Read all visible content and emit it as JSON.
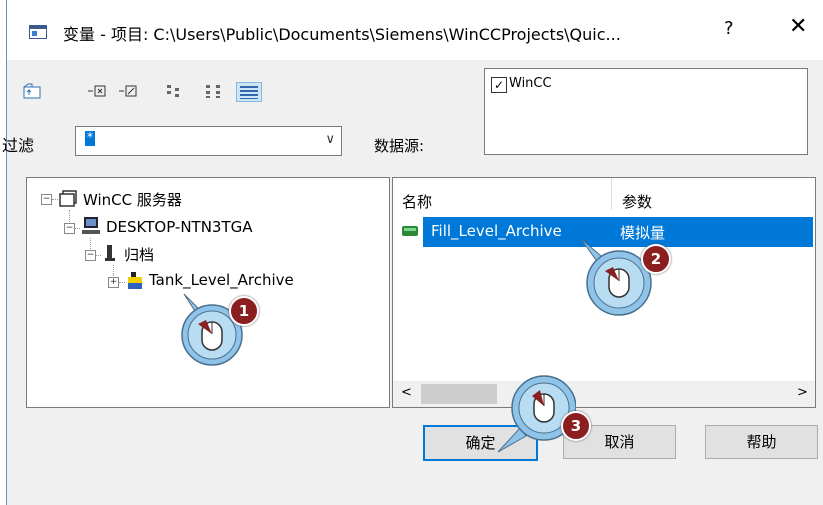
{
  "window": {
    "title": "变量 - 项目: C:\\Users\\Public\\Documents\\Siemens\\WinCCProjects\\Quic...",
    "help_glyph": "?",
    "close_glyph": "✕"
  },
  "toolbar": {
    "icons": [
      "folder-up-icon",
      "expand-icon",
      "collapse-icon",
      "list-view-icon",
      "small-icon-view-icon",
      "details-view-icon"
    ]
  },
  "filter": {
    "label": "过滤",
    "value": "*",
    "arrow": "∨"
  },
  "data_source": {
    "label": "数据源:",
    "items": [
      {
        "label": "WinCC",
        "checked": true,
        "check_glyph": "✓"
      }
    ]
  },
  "tree": {
    "items": [
      {
        "label": "WinCC 服务器",
        "icon": "server-icon"
      },
      {
        "label": "DESKTOP-NTN3TGA",
        "icon": "computer-icon"
      },
      {
        "label": "归档",
        "icon": "archive-icon"
      },
      {
        "label": "Tank_Level_Archive",
        "icon": "tank-archive-icon"
      }
    ]
  },
  "list": {
    "columns": [
      "名称",
      "参数"
    ],
    "rows": [
      {
        "name": "Fill_Level_Archive",
        "param": "模拟量",
        "selected": true
      }
    ],
    "scroll_left": "<",
    "scroll_right": ">"
  },
  "buttons": {
    "ok": "确定",
    "cancel": "取消",
    "help": "帮助"
  },
  "callouts": [
    {
      "number": "1"
    },
    {
      "number": "2"
    },
    {
      "number": "3"
    }
  ],
  "colors": {
    "selection": "#0078d7",
    "callout_badge": "#8b1e1e",
    "callout_cursor": "#8fc3e8"
  }
}
